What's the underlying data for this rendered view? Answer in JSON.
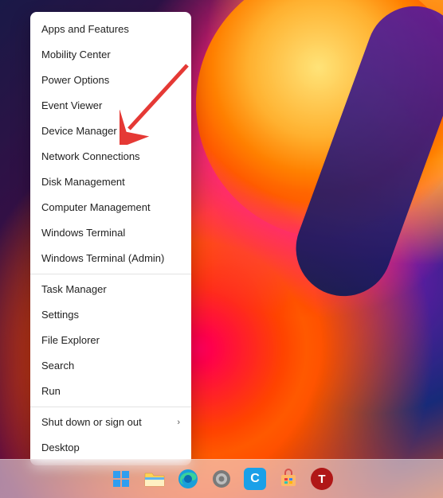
{
  "menu": {
    "groups": [
      [
        {
          "label": "Apps and Features",
          "name": "menu-item-apps-and-features",
          "arrow": false
        },
        {
          "label": "Mobility Center",
          "name": "menu-item-mobility-center",
          "arrow": false
        },
        {
          "label": "Power Options",
          "name": "menu-item-power-options",
          "arrow": false
        },
        {
          "label": "Event Viewer",
          "name": "menu-item-event-viewer",
          "arrow": false
        },
        {
          "label": "Device Manager",
          "name": "menu-item-device-manager",
          "arrow": false
        },
        {
          "label": "Network Connections",
          "name": "menu-item-network-connections",
          "arrow": false
        },
        {
          "label": "Disk Management",
          "name": "menu-item-disk-management",
          "arrow": false
        },
        {
          "label": "Computer Management",
          "name": "menu-item-computer-management",
          "arrow": false
        },
        {
          "label": "Windows Terminal",
          "name": "menu-item-windows-terminal",
          "arrow": false
        },
        {
          "label": "Windows Terminal (Admin)",
          "name": "menu-item-windows-terminal-admin",
          "arrow": false
        }
      ],
      [
        {
          "label": "Task Manager",
          "name": "menu-item-task-manager",
          "arrow": false
        },
        {
          "label": "Settings",
          "name": "menu-item-settings",
          "arrow": false
        },
        {
          "label": "File Explorer",
          "name": "menu-item-file-explorer",
          "arrow": false
        },
        {
          "label": "Search",
          "name": "menu-item-search",
          "arrow": false
        },
        {
          "label": "Run",
          "name": "menu-item-run",
          "arrow": false
        }
      ],
      [
        {
          "label": "Shut down or sign out",
          "name": "menu-item-shutdown-signout",
          "arrow": true
        },
        {
          "label": "Desktop",
          "name": "menu-item-desktop",
          "arrow": false
        }
      ]
    ]
  },
  "annotation": {
    "target_name": "menu-item-device-manager",
    "color": "#e53935"
  },
  "taskbar": {
    "items": [
      {
        "name": "start-button",
        "label": "Start"
      },
      {
        "name": "file-explorer-icon",
        "label": "File Explorer"
      },
      {
        "name": "edge-icon",
        "label": "Microsoft Edge"
      },
      {
        "name": "settings-icon",
        "label": "Settings"
      },
      {
        "name": "cortana-icon",
        "label": "Cortana"
      },
      {
        "name": "store-icon",
        "label": "Microsoft Store"
      },
      {
        "name": "app-t-icon",
        "label": "T"
      }
    ]
  }
}
